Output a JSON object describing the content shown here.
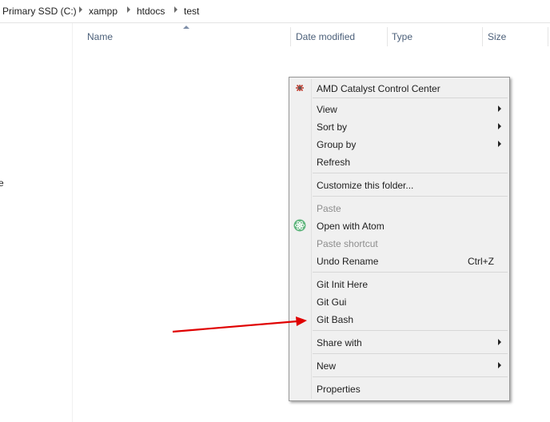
{
  "breadcrumb": {
    "items": [
      "Primary SSD (C:)",
      "xampp",
      "htdocs",
      "test"
    ]
  },
  "nav": {
    "fragment": "e"
  },
  "columns": {
    "name": "Name",
    "date_modified": "Date modified",
    "type": "Type",
    "size": "Size"
  },
  "context_menu": {
    "amd": "AMD Catalyst Control Center",
    "view": "View",
    "sort_by": "Sort by",
    "group_by": "Group by",
    "refresh": "Refresh",
    "customize": "Customize this folder...",
    "paste": "Paste",
    "open_with_atom": "Open with Atom",
    "paste_shortcut": "Paste shortcut",
    "undo_rename": "Undo Rename",
    "undo_rename_shortcut": "Ctrl+Z",
    "git_init_here": "Git Init Here",
    "git_gui": "Git Gui",
    "git_bash": "Git Bash",
    "share_with": "Share with",
    "new": "New",
    "properties": "Properties"
  },
  "icons": {
    "amd": "amd-catalyst-icon",
    "atom": "atom-icon",
    "annotation": "red-arrow"
  },
  "colors": {
    "menu_bg": "#f0f0f0",
    "disabled_text": "#8d8d8d",
    "header_text": "#4c607a",
    "annotation_arrow": "#e00000"
  }
}
